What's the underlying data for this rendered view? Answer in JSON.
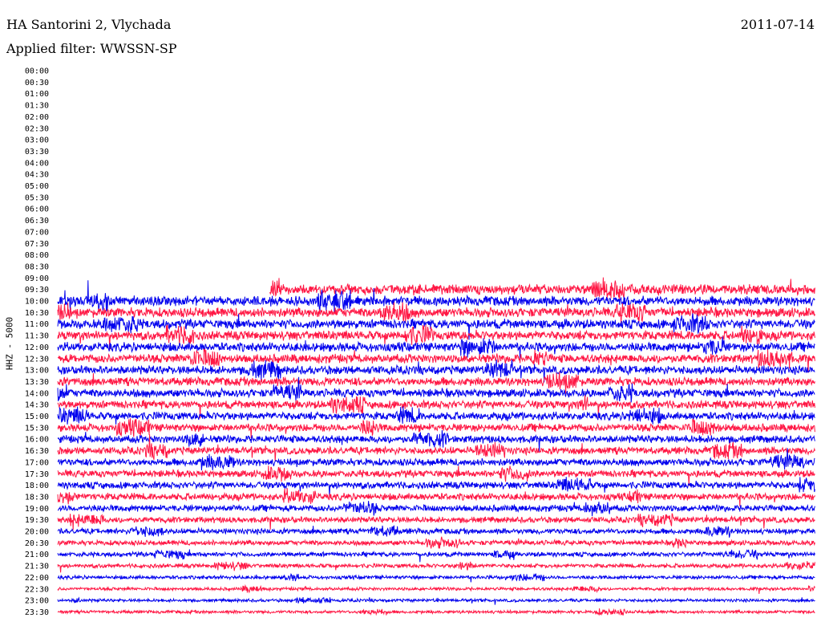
{
  "header": {
    "station": "HA Santorini 2, Vlychada",
    "filter": "Applied filter: WWSSN-SP",
    "date": "2011-07-14"
  },
  "chart_data": {
    "type": "line",
    "title": "HA Santorini 2, Vlychada",
    "subtitle": "Applied filter: WWSSN-SP",
    "ylabel": "HHZ - 5000",
    "xlabel": "",
    "row_labels": [
      "00:00",
      "00:30",
      "01:00",
      "01:30",
      "02:00",
      "02:30",
      "03:00",
      "03:30",
      "04:00",
      "04:30",
      "05:00",
      "05:30",
      "06:00",
      "06:30",
      "07:00",
      "07:30",
      "08:00",
      "08:30",
      "09:00",
      "09:30",
      "10:00",
      "10:30",
      "11:00",
      "11:30",
      "12:00",
      "12:30",
      "13:00",
      "13:30",
      "14:00",
      "14:30",
      "15:00",
      "15:30",
      "16:00",
      "16:30",
      "17:00",
      "17:30",
      "18:00",
      "18:30",
      "19:00",
      "19:30",
      "20:00",
      "20:30",
      "21:00",
      "21:30",
      "22:00",
      "22:30",
      "23:00",
      "23:30"
    ],
    "series_colors": [
      "#ff1744",
      "#0000ee"
    ],
    "rows_with_data_start": "09:30",
    "first_row_start_fraction": 0.28,
    "grid": false,
    "legend": "none"
  }
}
